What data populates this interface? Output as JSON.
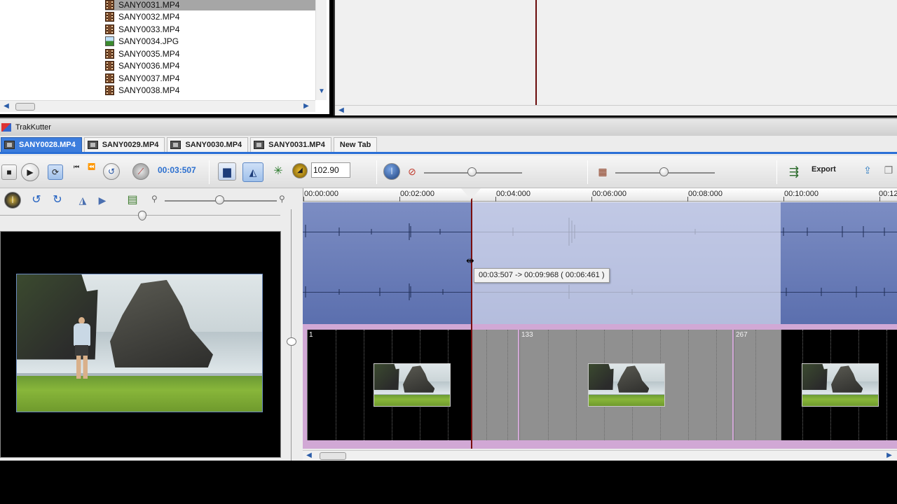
{
  "file_browser": {
    "files": [
      {
        "name": "SANY0031.MP4",
        "type": "video",
        "selected": true
      },
      {
        "name": "SANY0032.MP4",
        "type": "video",
        "selected": false
      },
      {
        "name": "SANY0033.MP4",
        "type": "video",
        "selected": false
      },
      {
        "name": "SANY0034.JPG",
        "type": "image",
        "selected": false
      },
      {
        "name": "SANY0035.MP4",
        "type": "video",
        "selected": false
      },
      {
        "name": "SANY0036.MP4",
        "type": "video",
        "selected": false
      },
      {
        "name": "SANY0037.MP4",
        "type": "video",
        "selected": false
      },
      {
        "name": "SANY0038.MP4",
        "type": "video",
        "selected": false
      }
    ]
  },
  "app": {
    "title": "TrakKutter",
    "tabs": [
      {
        "label": "SANY0028.MP4",
        "active": true
      },
      {
        "label": "SANY0029.MP4",
        "active": false
      },
      {
        "label": "SANY0030.MP4",
        "active": false
      },
      {
        "label": "SANY0031.MP4",
        "active": false
      },
      {
        "label": "New Tab",
        "active": false
      }
    ]
  },
  "toolbar": {
    "current_time": "00:03:507",
    "speed_value": "102.90",
    "export_label": "Export",
    "volume_level": 0.5,
    "brightness_level": 0.5
  },
  "timeline": {
    "ruler_ticks": [
      "00:00:000",
      "00:02:000",
      "00:04:000",
      "00:06:000",
      "00:08:000",
      "00:10:000",
      "00:12"
    ],
    "selection_tooltip": "00:03:507 -> 00:09:968 ( 00:06:461 )",
    "clips": [
      {
        "number": "1"
      },
      {
        "number": "133"
      },
      {
        "number": "267"
      }
    ]
  },
  "colors": {
    "accent": "#2b70d6",
    "waveform_bg": "#6b7dbb",
    "clip_strip": "#d1a8d5",
    "playhead": "#7a0e0e"
  },
  "icons": [
    "stop-icon",
    "play-icon",
    "loop-icon",
    "skip-start-icon",
    "skip-back-icon",
    "jump-icon",
    "speed-dial-icon",
    "levels-icon",
    "waveform-toggle-icon",
    "effects-icon",
    "tempo-knob-icon",
    "brightness-icon",
    "mute-icon",
    "film-icon",
    "export-icon",
    "upload-icon",
    "copy-icon",
    "power-icon",
    "rotate-left-icon",
    "rotate-right-icon",
    "flip-horizontal-icon",
    "flip-vertical-icon",
    "insert-clip-icon",
    "zoom-out-icon",
    "zoom-in-icon"
  ]
}
